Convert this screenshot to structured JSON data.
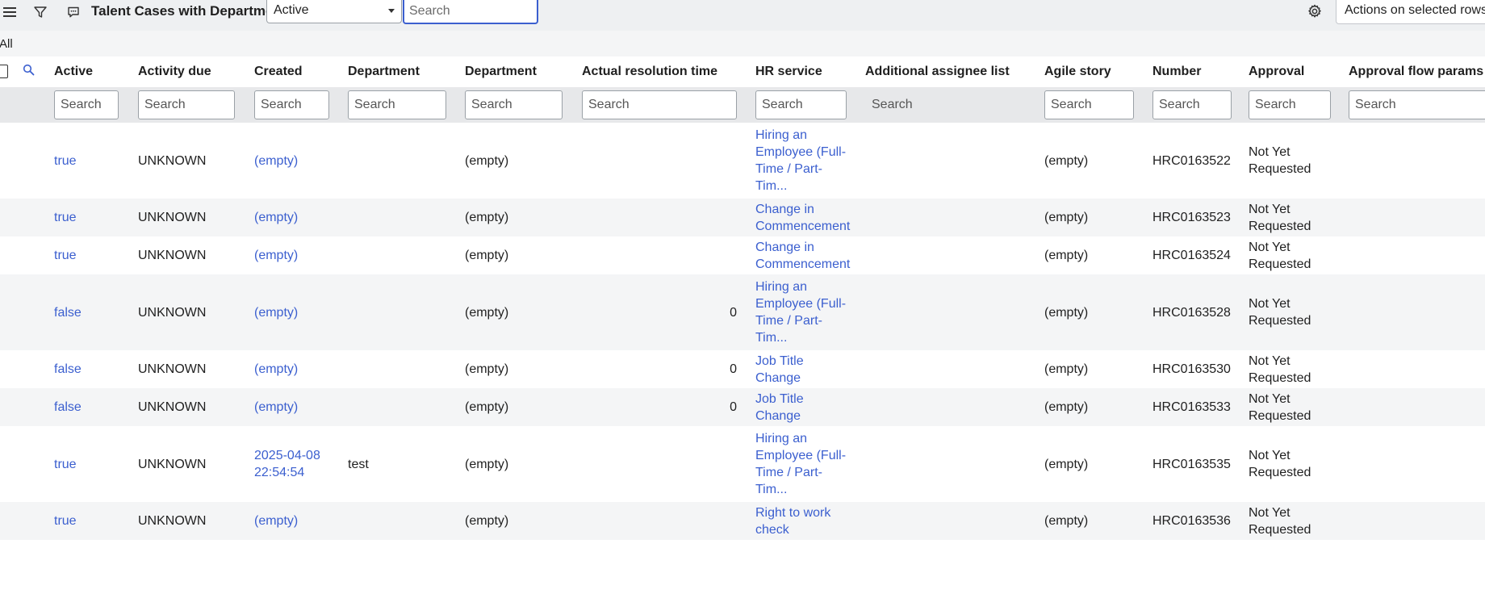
{
  "toolbar": {
    "list_title": "Talent Cases with Department",
    "filter_select_value": "Active",
    "search_placeholder": "Search",
    "actions_label": "Actions on selected rows..."
  },
  "breadcrumb": {
    "label": "All"
  },
  "columns": [
    "Active",
    "Activity due",
    "Created",
    "Department",
    "Department",
    "Actual resolution time",
    "HR service",
    "Additional assignee list",
    "Agile story",
    "Number",
    "Approval",
    "Approval flow params"
  ],
  "filter_placeholder": "Search",
  "rows": [
    {
      "active": "true",
      "activity_due": "UNKNOWN",
      "created": "(empty)",
      "department": "",
      "department2": "(empty)",
      "actual_resolution": "",
      "hr_service": "Hiring an Employee (Full-Time / Part-Tim...",
      "additional_assignee": "",
      "agile_story": "(empty)",
      "number": "HRC0163522",
      "approval": "Not Yet Requested",
      "approval_flow": ""
    },
    {
      "active": "true",
      "activity_due": "UNKNOWN",
      "created": "(empty)",
      "department": "",
      "department2": "(empty)",
      "actual_resolution": "",
      "hr_service": "Change in Commencement",
      "additional_assignee": "",
      "agile_story": "(empty)",
      "number": "HRC0163523",
      "approval": "Not Yet Requested",
      "approval_flow": ""
    },
    {
      "active": "true",
      "activity_due": "UNKNOWN",
      "created": "(empty)",
      "department": "",
      "department2": "(empty)",
      "actual_resolution": "",
      "hr_service": "Change in Commencement",
      "additional_assignee": "",
      "agile_story": "(empty)",
      "number": "HRC0163524",
      "approval": "Not Yet Requested",
      "approval_flow": ""
    },
    {
      "active": "false",
      "activity_due": "UNKNOWN",
      "created": "(empty)",
      "department": "",
      "department2": "(empty)",
      "actual_resolution": "0",
      "hr_service": "Hiring an Employee (Full-Time / Part-Tim...",
      "additional_assignee": "",
      "agile_story": "(empty)",
      "number": "HRC0163528",
      "approval": "Not Yet Requested",
      "approval_flow": ""
    },
    {
      "active": "false",
      "activity_due": "UNKNOWN",
      "created": "(empty)",
      "department": "",
      "department2": "(empty)",
      "actual_resolution": "0",
      "hr_service": "Job Title Change",
      "additional_assignee": "",
      "agile_story": "(empty)",
      "number": "HRC0163530",
      "approval": "Not Yet Requested",
      "approval_flow": ""
    },
    {
      "active": "false",
      "activity_due": "UNKNOWN",
      "created": "(empty)",
      "department": "",
      "department2": "(empty)",
      "actual_resolution": "0",
      "hr_service": "Job Title Change",
      "additional_assignee": "",
      "agile_story": "(empty)",
      "number": "HRC0163533",
      "approval": "Not Yet Requested",
      "approval_flow": ""
    },
    {
      "active": "true",
      "activity_due": "UNKNOWN",
      "created": "2025-04-08 22:54:54",
      "department": "test",
      "department2": "(empty)",
      "actual_resolution": "",
      "hr_service": "Hiring an Employee (Full-Time / Part-Tim...",
      "additional_assignee": "",
      "agile_story": "(empty)",
      "number": "HRC0163535",
      "approval": "Not Yet Requested",
      "approval_flow": ""
    },
    {
      "active": "true",
      "activity_due": "UNKNOWN",
      "created": "(empty)",
      "department": "",
      "department2": "(empty)",
      "actual_resolution": "",
      "hr_service": "Right to work check",
      "additional_assignee": "",
      "agile_story": "(empty)",
      "number": "HRC0163536",
      "approval": "Not Yet Requested",
      "approval_flow": ""
    }
  ],
  "colors": {
    "link": "#3b5fcf",
    "focus_border": "#3b5fcf",
    "toolbar_bg": "#eef0f2",
    "stripe_bg": "#f4f5f6"
  },
  "icons": {
    "menu": "hamburger-menu-icon",
    "filter": "funnel-icon",
    "comment": "chat-bubble-icon",
    "search": "magnifier-icon",
    "settings": "gear-icon"
  }
}
